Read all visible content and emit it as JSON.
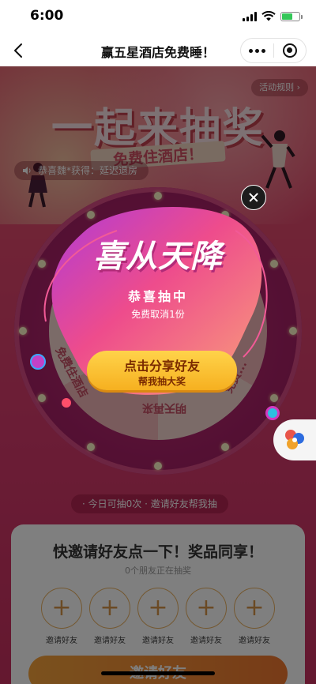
{
  "status_bar": {
    "time": "6:00"
  },
  "nav": {
    "title": "赢五星酒店免费睡！"
  },
  "banner": {
    "rules_label": "活动规则",
    "title": "一起来抽奖",
    "subtitle": "免费住酒店！",
    "notice": "恭喜魏*获得：延迟退房"
  },
  "wheel": {
    "prizes": [
      "明天再来",
      "免费住酒店",
      "免费..."
    ]
  },
  "share_hint": "· 今日可抽0次 · 邀请好友帮我抽",
  "invite": {
    "title": "快邀请好友点一下！奖品同享！",
    "subtitle": "0个朋友正在抽奖",
    "slots": [
      {
        "label": "邀请好友"
      },
      {
        "label": "邀请好友"
      },
      {
        "label": "邀请好友"
      },
      {
        "label": "邀请好友"
      },
      {
        "label": "邀请好友"
      }
    ],
    "button_label": "邀请好友"
  },
  "modal": {
    "title": "喜从天降",
    "subtitle": "恭喜抽中",
    "prize": "免费取消1份",
    "button_main": "点击分享好友",
    "button_sub": "帮我抽大奖"
  },
  "colors": {
    "page_top": "#e85a6e",
    "page_bottom": "#c8305f",
    "accent": "#f6b020",
    "modal_pink": "#f0558a"
  }
}
